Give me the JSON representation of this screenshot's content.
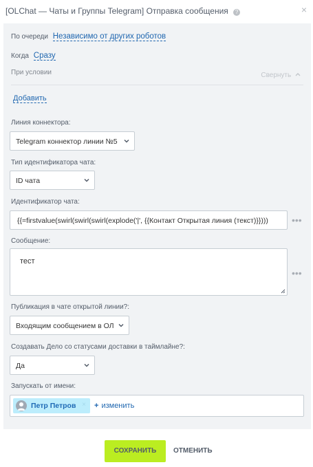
{
  "window": {
    "title": "[OLChat — Чаты и Группы Telegram] Отправка сообщения",
    "help_glyph": "?",
    "close_glyph": "×"
  },
  "queue": {
    "label": "По очереди",
    "value": "Независимо от других роботов"
  },
  "when": {
    "label": "Когда",
    "value": "Сразу"
  },
  "condition": {
    "label": "При условии",
    "collapse_label": "Свернуть"
  },
  "add_label": "Добавить",
  "connector_line": {
    "label": "Линия коннектора:",
    "value": "Telegram коннектор линии №5"
  },
  "chat_id_type": {
    "label": "Тип идентификатора чата:",
    "value": "ID чата"
  },
  "chat_id": {
    "label": "Идентификатор чата:",
    "value": "{{=firstvalue(swirl(swirl(swirl(explode('|', {{Контакт Открытая линия (текст)}})))"
  },
  "message": {
    "label": "Сообщение:",
    "value": "тест"
  },
  "publication": {
    "label": "Публикация в чате открытой линии?:",
    "value": "Входящим сообщением в ОЛ"
  },
  "create_deal": {
    "label": "Создавать Дело со статусами доставки в таймлайне?:",
    "value": "Да"
  },
  "run_as": {
    "label": "Запускать от имени:",
    "user": "Петр Петров",
    "remove_glyph": "×",
    "change_plus": "+",
    "change_label": "изменить"
  },
  "more_glyph": "•••",
  "footer": {
    "save_label": "СОХРАНИТЬ",
    "cancel_label": "ОТМЕНИТЬ"
  },
  "colors": {
    "accent": "#bbed21",
    "link": "#2067b0",
    "panel": "#f1f3f5"
  }
}
